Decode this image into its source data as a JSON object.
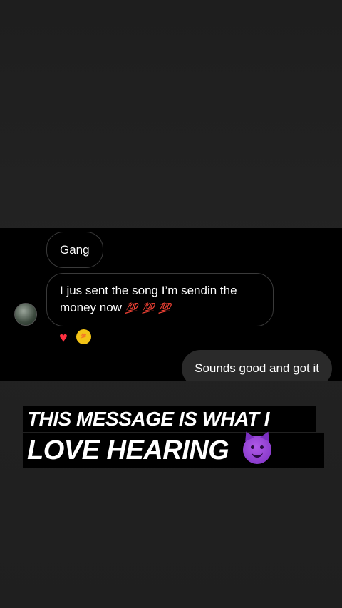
{
  "conversation": {
    "messages": [
      {
        "direction": "incoming",
        "text": "Gang"
      },
      {
        "direction": "incoming",
        "text": "I jus sent the song I’m sendin the money now",
        "emoji": "💯 💯 💯"
      },
      {
        "direction": "outgoing",
        "text": "Sounds good and got it"
      }
    ],
    "reactions": [
      "heart-icon",
      "sticker-icon"
    ],
    "sticker_label": "💯"
  },
  "caption": {
    "line1": "THIS MESSAGE IS WHAT I",
    "line2": "LOVE HEARING"
  },
  "colors": {
    "background": "#202020",
    "screenshot_bg": "#000000",
    "outgoing_bubble": "#2a2a2a",
    "heart": "#ff3040",
    "emoji_red": "#e0202a",
    "devil_purple": "#9b45d6"
  }
}
